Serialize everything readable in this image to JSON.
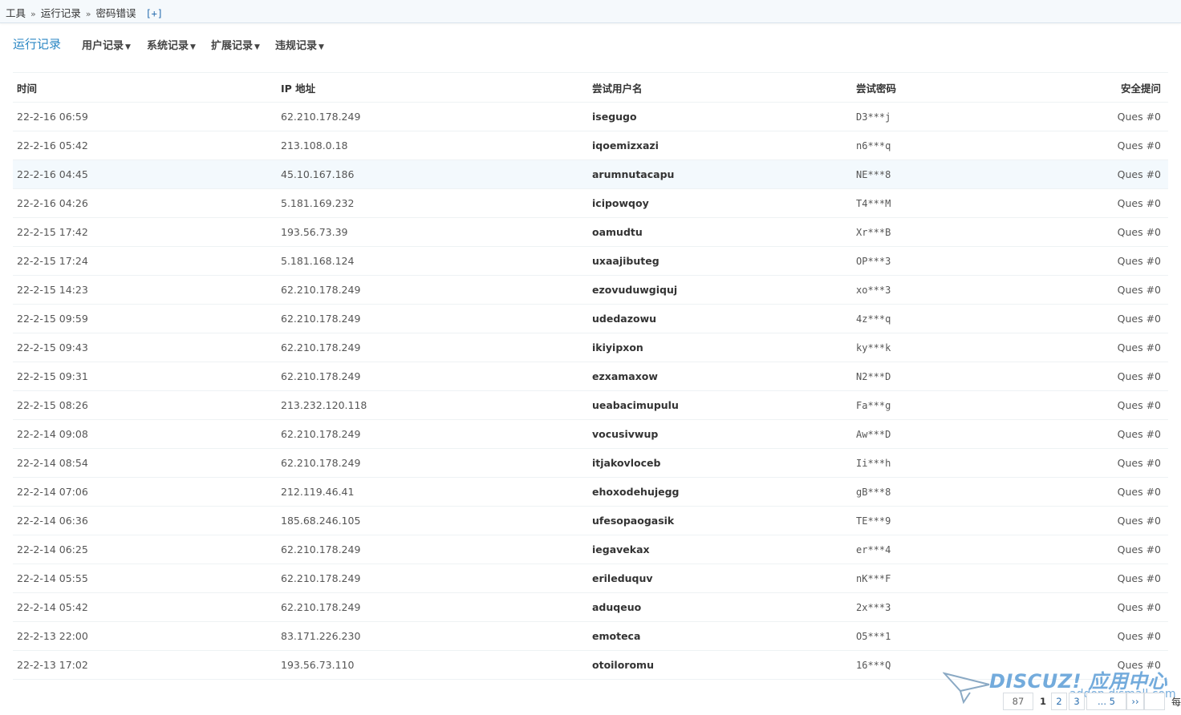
{
  "breadcrumb": {
    "items": [
      "工具",
      "运行记录",
      "密码错误"
    ],
    "separator": "»",
    "add": "[+]"
  },
  "tabs": [
    {
      "label": "运行记录",
      "active": true
    },
    {
      "label": "用户记录",
      "dropdown": true
    },
    {
      "label": "系统记录",
      "dropdown": true
    },
    {
      "label": "扩展记录",
      "dropdown": true
    },
    {
      "label": "违规记录",
      "dropdown": true
    }
  ],
  "table": {
    "headers": [
      "时间",
      "IP 地址",
      "尝试用户名",
      "尝试密码",
      "安全提问"
    ],
    "rows": [
      [
        "22-2-16 06:59",
        "62.210.178.249",
        "isegugo",
        "D3***j",
        "Ques #0"
      ],
      [
        "22-2-16 05:42",
        "213.108.0.18",
        "iqoemizxazi",
        "n6***q",
        "Ques #0"
      ],
      [
        "22-2-16 04:45",
        "45.10.167.186",
        "arumnutacapu",
        "NE***8",
        "Ques #0"
      ],
      [
        "22-2-16 04:26",
        "5.181.169.232",
        "icipowqoy",
        "T4***M",
        "Ques #0"
      ],
      [
        "22-2-15 17:42",
        "193.56.73.39",
        "oamudtu",
        "Xr***B",
        "Ques #0"
      ],
      [
        "22-2-15 17:24",
        "5.181.168.124",
        "uxaajibuteg",
        "OP***3",
        "Ques #0"
      ],
      [
        "22-2-15 14:23",
        "62.210.178.249",
        "ezovuduwgiquj",
        "xo***3",
        "Ques #0"
      ],
      [
        "22-2-15 09:59",
        "62.210.178.249",
        "udedazowu",
        "4z***q",
        "Ques #0"
      ],
      [
        "22-2-15 09:43",
        "62.210.178.249",
        "ikiyipxon",
        "ky***k",
        "Ques #0"
      ],
      [
        "22-2-15 09:31",
        "62.210.178.249",
        "ezxamaxow",
        "N2***D",
        "Ques #0"
      ],
      [
        "22-2-15 08:26",
        "213.232.120.118",
        "ueabacimupulu",
        "Fa***g",
        "Ques #0"
      ],
      [
        "22-2-14 09:08",
        "62.210.178.249",
        "vocusivwup",
        "Aw***D",
        "Ques #0"
      ],
      [
        "22-2-14 08:54",
        "62.210.178.249",
        "itjakovloceb",
        "Ii***h",
        "Ques #0"
      ],
      [
        "22-2-14 07:06",
        "212.119.46.41",
        "ehoxodehujegg",
        "gB***8",
        "Ques #0"
      ],
      [
        "22-2-14 06:36",
        "185.68.246.105",
        "ufesopaogasik",
        "TE***9",
        "Ques #0"
      ],
      [
        "22-2-14 06:25",
        "62.210.178.249",
        "iegavekax",
        "er***4",
        "Ques #0"
      ],
      [
        "22-2-14 05:55",
        "62.210.178.249",
        "erileduquv",
        "nK***F",
        "Ques #0"
      ],
      [
        "22-2-14 05:42",
        "62.210.178.249",
        "aduqeuo",
        "2x***3",
        "Ques #0"
      ],
      [
        "22-2-13 22:00",
        "83.171.226.230",
        "emoteca",
        "O5***1",
        "Ques #0"
      ],
      [
        "22-2-13 17:02",
        "193.56.73.110",
        "otoiloromu",
        "16***Q",
        "Ques #0"
      ]
    ],
    "highlight_row": 2
  },
  "pagination": {
    "total": "87",
    "current": "1",
    "pages": [
      "2",
      "3"
    ],
    "ellipsis": "... 5",
    "next": "››",
    "per_page_label": "每"
  },
  "watermark": {
    "title": "DISCUZ! 应用中心",
    "subtitle": "addon.dismall.com"
  },
  "colors": {
    "link": "#2b6fb0",
    "active_tab": "#2b87c4",
    "highlight_row": "#f3f9fd"
  }
}
